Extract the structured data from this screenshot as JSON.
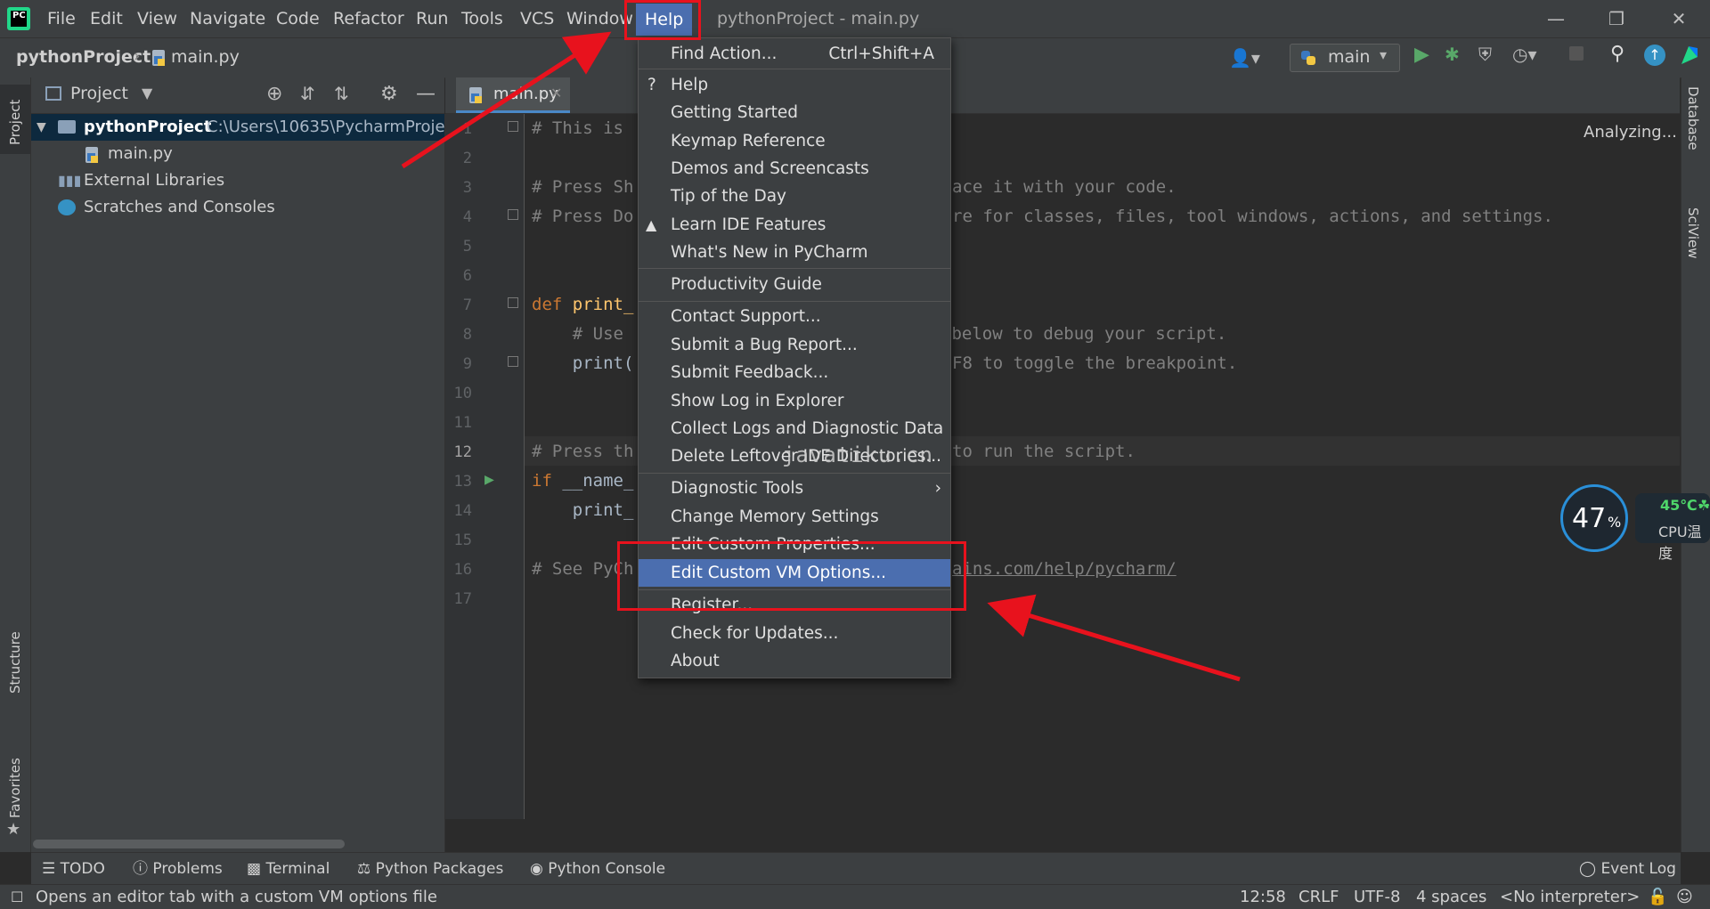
{
  "menubar": {
    "logo_text": "PC",
    "items": [
      "File",
      "Edit",
      "View",
      "Navigate",
      "Code",
      "Refactor",
      "Run",
      "Tools",
      "VCS",
      "Window",
      "Help"
    ],
    "window_title": "pythonProject - main.py"
  },
  "navbar": {
    "project": "pythonProject",
    "file": "main.py",
    "run_config": "main"
  },
  "project_panel": {
    "title": "Project",
    "root_name": "pythonProject",
    "root_path": "C:\\Users\\10635\\PycharmProjec",
    "file": "main.py",
    "external_libraries": "External Libraries",
    "scratches": "Scratches and Consoles"
  },
  "left_stripe": {
    "project": "Project",
    "structure": "Structure",
    "favorites": "Favorites"
  },
  "right_stripe": {
    "database": "Database",
    "sciview": "SciView"
  },
  "editor": {
    "tab": "main.py",
    "status": "Analyzing...",
    "line_numbers": [
      "1",
      "2",
      "3",
      "4",
      "5",
      "6",
      "7",
      "8",
      "9",
      "10",
      "11",
      "12",
      "13",
      "14",
      "15",
      "16",
      "17"
    ],
    "lines": {
      "l1": "# This is ",
      "l3a": "# Press Sh",
      "l3b": "ace it with your code.",
      "l4a": "# Press Do",
      "l4b": "re for classes, files, tool windows, actions, and settings.",
      "l7_kw": "def ",
      "l7_fn": "print_",
      "l8a": "    # Use ",
      "l8b": " below to debug your script.",
      "l9a": "    print(",
      "l9b": "F8 to toggle the breakpoint.",
      "l12a": "# Press th",
      "l12b": "to run the script.",
      "l13_kw": "if ",
      "l13_rest": "__name_",
      "l14": "    print_",
      "l16a": "# See PyCh",
      "l16b": "ains.com/help/pycharm/"
    }
  },
  "help_menu": {
    "find_action": "Find Action...",
    "find_action_shortcut": "Ctrl+Shift+A",
    "help": "Help",
    "getting_started": "Getting Started",
    "keymap_reference": "Keymap Reference",
    "demos": "Demos and Screencasts",
    "tip": "Tip of the Day",
    "learn": "Learn IDE Features",
    "whats_new": "What's New in PyCharm",
    "productivity": "Productivity Guide",
    "contact_support": "Contact Support...",
    "bug_report": "Submit a Bug Report...",
    "feedback": "Submit Feedback...",
    "show_log": "Show Log in Explorer",
    "collect_logs": "Collect Logs and Diagnostic Data",
    "delete_leftover": "Delete Leftover IDE Directories...",
    "diagnostic_tools": "Diagnostic Tools",
    "memory_settings": "Change Memory Settings",
    "custom_properties": "Edit Custom Properties...",
    "custom_vm_options": "Edit Custom VM Options...",
    "register": "Register...",
    "check_updates": "Check for Updates...",
    "about": "About"
  },
  "watermark": "javatiku.cn",
  "cpu_widget": {
    "percent": "47",
    "percent_sign": "%",
    "temperature": "45℃",
    "label": "CPU温度"
  },
  "bottom_toolbar": {
    "todo": "TODO",
    "problems": "Problems",
    "terminal": "Terminal",
    "python_packages": "Python Packages",
    "python_console": "Python Console",
    "event_log": "Event Log"
  },
  "status_bar": {
    "message": "Opens an editor tab with a custom VM options file",
    "position": "12:58",
    "line_sep": "CRLF",
    "encoding": "UTF-8",
    "indent": "4 spaces",
    "interpreter": "<No interpreter>"
  },
  "colors": {
    "accent": "#4b6eaf",
    "annotation": "#e8121d",
    "background": "#2b2b2b",
    "panel": "#3c3f41"
  }
}
